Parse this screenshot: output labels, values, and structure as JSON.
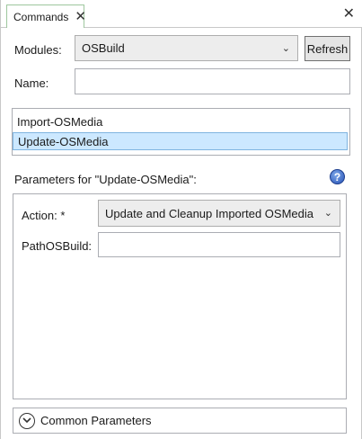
{
  "tab": {
    "label": "Commands",
    "close_icon": "close-icon"
  },
  "pane": {
    "close_icon": "close-icon"
  },
  "modules": {
    "label": "Modules:",
    "selected": "OSBuild",
    "refresh_label": "Refresh"
  },
  "name": {
    "label": "Name:",
    "value": ""
  },
  "commands": [
    {
      "label": "Import-OSMedia",
      "selected": false
    },
    {
      "label": "Update-OSMedia",
      "selected": true
    }
  ],
  "parameters": {
    "header": "Parameters for \"Update-OSMedia\":",
    "help_icon": "help-icon",
    "action": {
      "label": "Action: *",
      "selected": "Update and Cleanup Imported OSMedia"
    },
    "path": {
      "label": "PathOSBuild:",
      "value": ""
    }
  },
  "common": {
    "label": "Common Parameters",
    "icon": "chevron-down-circle-icon"
  },
  "colors": {
    "selection_bg": "#cce8ff",
    "selection_border": "#7fb4e0",
    "help_icon": "#2853b8",
    "tab_border": "#9ec79e"
  }
}
